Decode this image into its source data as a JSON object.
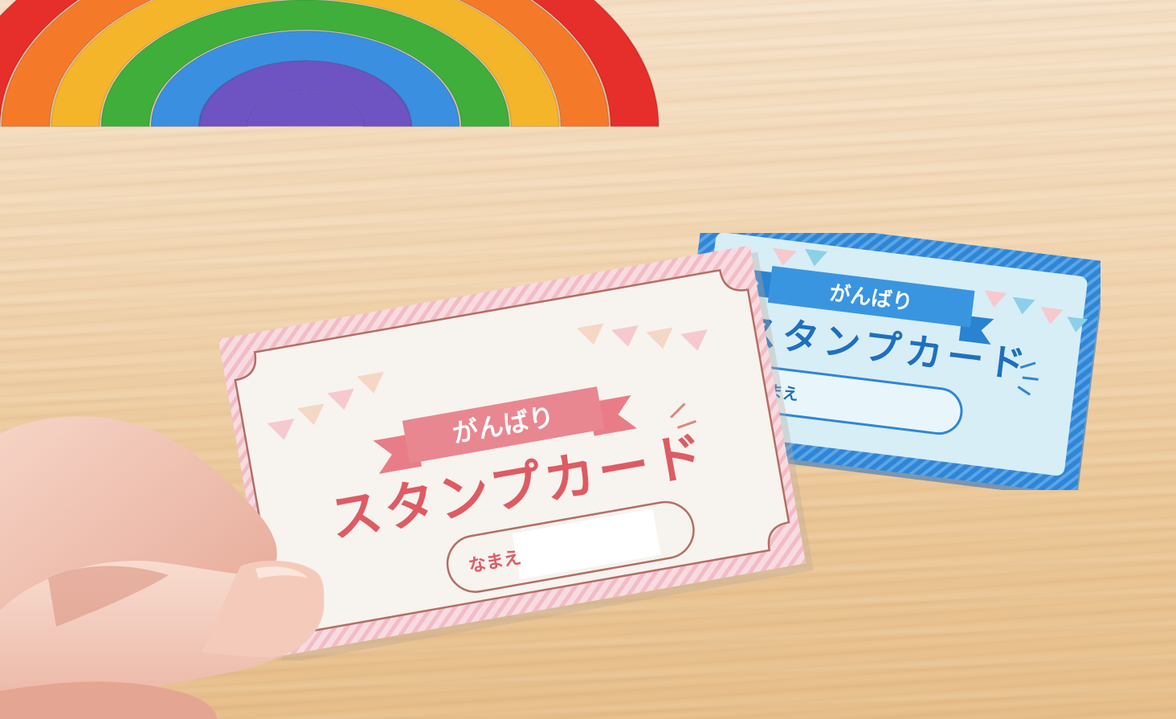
{
  "blue_card": {
    "ribbon_text": "がんばり",
    "title": "スタンプカード",
    "name_label": "なまえ",
    "colors": {
      "frame": "#2f86d6",
      "ribbon": "#2a82d2",
      "text": "#1f6fc0",
      "bg": "#d7eef6"
    }
  },
  "pink_card": {
    "ribbon_text": "がんばり",
    "title": "スタンプカード",
    "name_label": "なまえ",
    "colors": {
      "frame": "#f3c7cf",
      "ribbon": "#e87d87",
      "text": "#de5b63",
      "bg": "#f7f3ef",
      "outline": "#b46e64"
    }
  },
  "rainbow_colors": [
    "#e62e2a",
    "#f47a2a",
    "#f5b52a",
    "#3fae3a",
    "#3a8fe0",
    "#6e53c2"
  ]
}
